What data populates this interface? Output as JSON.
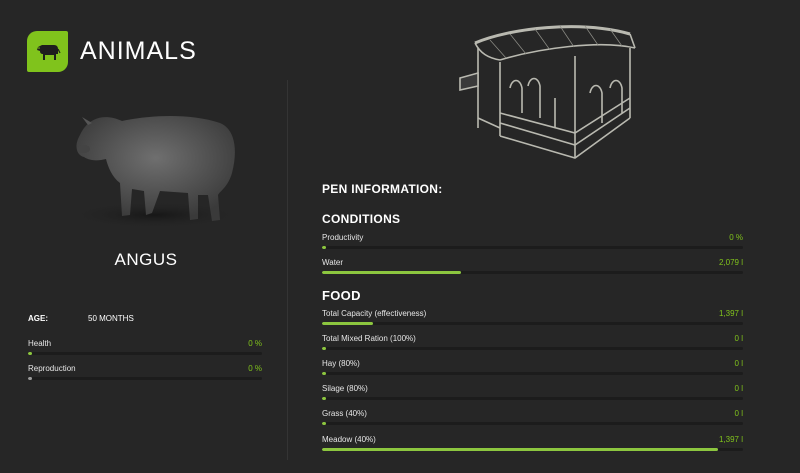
{
  "header": {
    "title": "ANIMALS",
    "icon": "cow-icon",
    "accent": "#80c31c"
  },
  "animal": {
    "name": "ANGUS",
    "age_label": "AGE:",
    "age_value": "50 MONTHS",
    "stats": [
      {
        "label": "Health",
        "value": "0 %",
        "level": 0.0
      },
      {
        "label": "Reproduction",
        "value": "0 %",
        "level": 0.0
      }
    ]
  },
  "pen": {
    "title": "PEN INFORMATION:",
    "conditions_heading": "CONDITIONS",
    "conditions": [
      {
        "label": "Productivity",
        "value": "0 %",
        "level": 0.0
      },
      {
        "label": "Water",
        "value": "2,079 l",
        "level": 0.33
      }
    ],
    "food_heading": "FOOD",
    "food": [
      {
        "label": "Total Capacity (effectiveness)",
        "value": "1,397 l",
        "level": 0.12
      },
      {
        "label": "Total Mixed Ration (100%)",
        "value": "0 l",
        "level": 0.0
      },
      {
        "label": "Hay (80%)",
        "value": "0 l",
        "level": 0.0
      },
      {
        "label": "Silage (80%)",
        "value": "0 l",
        "level": 0.0
      },
      {
        "label": "Grass (40%)",
        "value": "0 l",
        "level": 0.0
      },
      {
        "label": "Meadow (40%)",
        "value": "1,397 l",
        "level": 0.94
      }
    ]
  }
}
